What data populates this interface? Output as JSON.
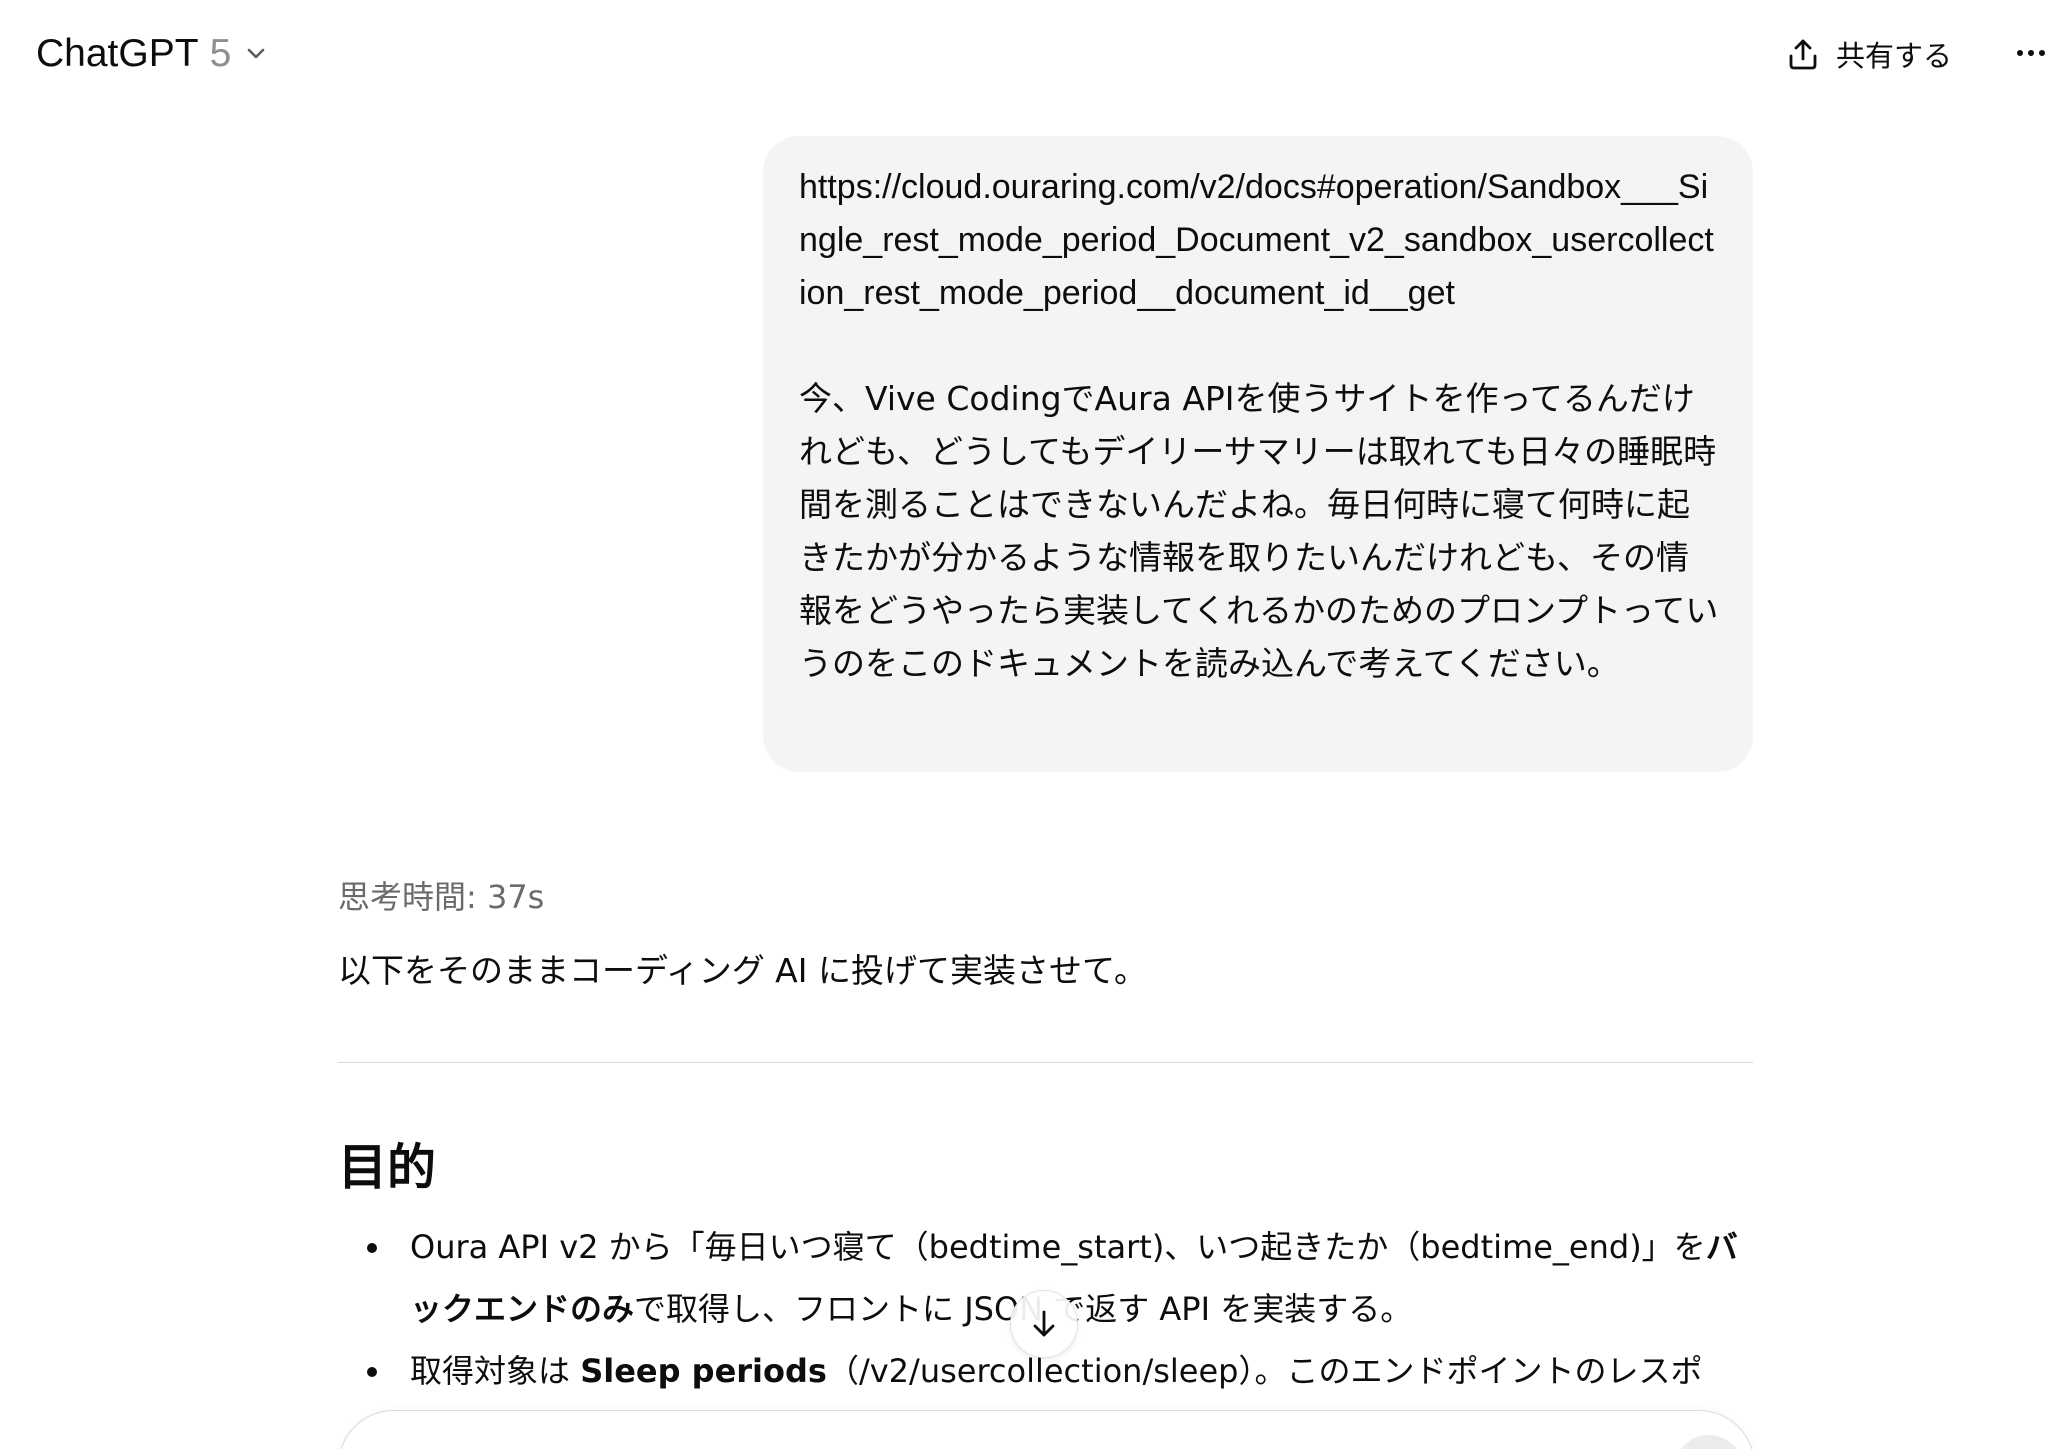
{
  "header": {
    "model_name": "ChatGPT",
    "model_version": "5",
    "share_label": "共有する"
  },
  "user_message": {
    "url": "https://cloud.ouraring.com/v2/docs#operation/Sandbox___Single_rest_mode_period_Document_v2_sandbox_usercollection_rest_mode_period__document_id__get",
    "text": "今、Vive CodingでAura APIを使うサイトを作ってるんだけれども、どうしてもデイリーサマリーは取れても日々の睡眠時間を測ることはできないんだよね。毎日何時に寝て何時に起きたかが分かるような情報を取りたいんだけれども、その情報をどうやったら実装してくれるかのためのプロンプトっていうのをこのドキュメントを読み込んで考えてください。"
  },
  "assistant": {
    "thought_time": "思考時間: 37s",
    "intro": "以下をそのままコーディング AI に投げて実装させて。",
    "section_heading": "目的",
    "bullets": [
      {
        "part1": "Oura API v2 から「毎日いつ寝て（bedtime_start)、いつ起きたか（bedtime_end)」を",
        "bold": "バックエンドのみ",
        "part2": "で取得し、フロントに JSON で返す API を実装する。"
      },
      {
        "part1": "取得対象は ",
        "bold": "Sleep periods",
        "part2": "（/v2/usercollection/sleep）。このエンドポイントのレスポ"
      }
    ]
  },
  "icons": {
    "chevron": "chevron-down-icon",
    "share": "share-icon",
    "more": "more-horizontal-icon",
    "scroll": "arrow-down-icon"
  }
}
